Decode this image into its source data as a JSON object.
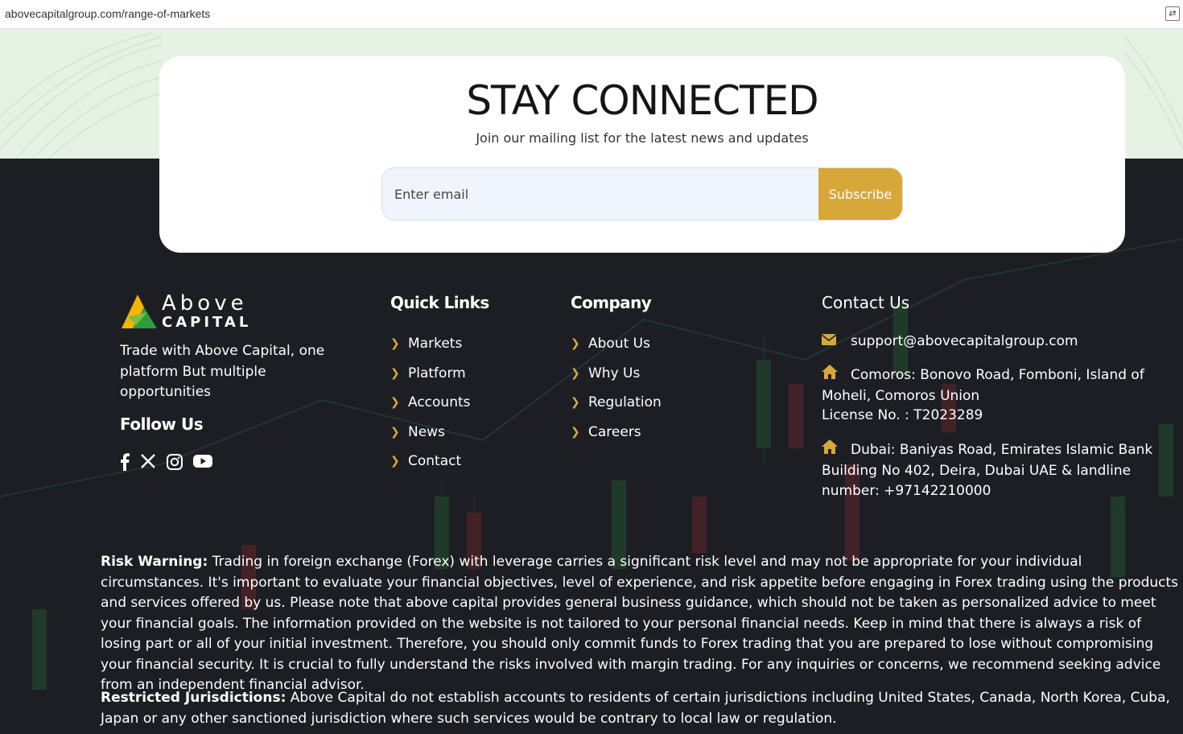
{
  "browser": {
    "url": "abovecapitalgroup.com/range-of-markets"
  },
  "newsletter": {
    "title": "STAY CONNECTED",
    "subtitle": "Join our mailing list for the latest news and updates",
    "email_placeholder": "Enter email",
    "subscribe_label": "Subscribe"
  },
  "brand": {
    "logo_word1": "Above",
    "logo_word2": "CAPITAL",
    "tagline": "Trade with Above Capital, one platform But multiple opportunities",
    "follow_label": "Follow Us",
    "socials": [
      "facebook-icon",
      "x-twitter-icon",
      "instagram-icon",
      "youtube-icon"
    ]
  },
  "quick_links": {
    "title": "Quick Links",
    "items": [
      "Markets",
      "Platform",
      "Accounts",
      "News",
      "Contact"
    ]
  },
  "company": {
    "title": "Company",
    "items": [
      "About Us",
      "Why Us",
      "Regulation",
      "Careers"
    ]
  },
  "contact": {
    "title": "Contact Us",
    "email": "support@abovecapitalgroup.com",
    "comoros_address": "Comoros: Bonovo Road, Fomboni, Island of Moheli, Comoros Union",
    "license": "License No. : T2023289",
    "dubai_address": "Dubai: Baniyas Road, Emirates Islamic Bank Building No 402, Deira, Dubai UAE & landline number: +97142210000"
  },
  "disclaimer": {
    "risk_label": "Risk Warning:",
    "risk_text": " Trading in foreign exchange (Forex) with leverage carries a significant risk level and may not be appropriate for your individual circumstances. It's important to evaluate your financial objectives, level of experience, and risk appetite before engaging in Forex trading using the products and services offered by us. Please note that above capital provides general business guidance, which should not be taken as personalized advice to meet your financial goals. The information provided on the website is not tailored to your personal financial needs. Keep in mind that there is always a risk of losing part or all of your initial investment. Therefore, you should only commit funds to Forex trading that you are prepared to lose without compromising your financial security. It is crucial to fully understand the risks involved with margin trading. For any inquiries or concerns, we recommend seeking advice from an independent financial advisor.",
    "restricted_label": "Restricted Jurisdictions:",
    "restricted_text": " Above Capital do not establish accounts to residents of certain jurisdictions including United States, Canada, North Korea, Cuba, Japan or any other sanctioned jurisdiction where such services would be contrary to local law or regulation."
  },
  "colors": {
    "accent": "#d8a73a",
    "dark_bg": "#1d1e24",
    "light_band": "#e6f2e4"
  }
}
